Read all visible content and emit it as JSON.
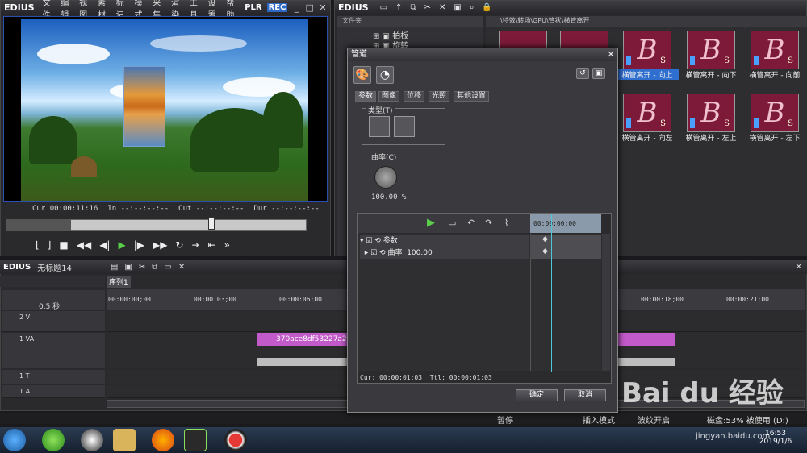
{
  "player": {
    "brand": "EDIUS",
    "menu": [
      "文件",
      "编辑",
      "视图",
      "素材",
      "标记",
      "模式",
      "采集",
      "渲染",
      "工具",
      "设置",
      "帮助"
    ],
    "plr": "PLR",
    "rec": "REC",
    "cur_label": "Cur",
    "cur_value": "00:00:11:16",
    "in_label": "In",
    "in_value": "--:--:--:--",
    "out_label": "Out",
    "out_value": "--:--:--:--",
    "dur_label": "Dur",
    "dur_value": "--:--:--:--"
  },
  "bin": {
    "brand": "EDIUS",
    "folder_header": "文件夹",
    "folders": [
      "拍板",
      "旋转"
    ],
    "path": "\\特效\\转场\\GPU\\管状\\横管离开",
    "thumbs": [
      {
        "label": ""
      },
      {
        "label": ""
      },
      {
        "label": "横管离开 - 向上"
      },
      {
        "label": "横管离开 - 向下"
      },
      {
        "label": "横管离开 - 向前"
      },
      {
        "label": "横管离开 - 向左"
      },
      {
        "label": "横管离开 - 左上"
      },
      {
        "label": "横管离开 - 左下"
      }
    ]
  },
  "timeline": {
    "brand": "EDIUS",
    "project": "无标题14",
    "sequence_tab": "序列1",
    "zoom": "0.5 秒",
    "ruler": [
      "00:00:00;00",
      "00:00:03;00",
      "00:00:06;00",
      "00:00:18;00",
      "00:00:21;00"
    ],
    "tracks": [
      {
        "name": "2 V"
      },
      {
        "name": "1 VA"
      },
      {
        "name": "1 T"
      },
      {
        "name": "1 A"
      }
    ],
    "clip_name": "370ace8df53227a204"
  },
  "status": {
    "pause": "暂停",
    "insert_mode": "插入模式",
    "ripple": "波纹开启",
    "disk": "磁盘:53% 被使用 (D:)"
  },
  "dialog": {
    "title": "管道",
    "tabs": [
      "参数",
      "图像",
      "位移",
      "光照",
      "其他设置"
    ],
    "type_label": "类型(T)",
    "curvature_label": "曲率(C)",
    "curvature_value": "100.00 %",
    "kf_ruler": "00:00:00:00",
    "kf_rows": [
      {
        "label": "参数"
      },
      {
        "label": "曲率",
        "value": "100.00"
      }
    ],
    "cur": "Cur: 00:00:01:03",
    "ttl": "Ttl: 00:00:01:03",
    "ok": "确定",
    "cancel": "取消"
  },
  "taskbar": {
    "time": "16:53",
    "date": "2019/1/6"
  },
  "watermark": {
    "text": "Bai du 经验",
    "url": "jingyan.baidu.com"
  }
}
